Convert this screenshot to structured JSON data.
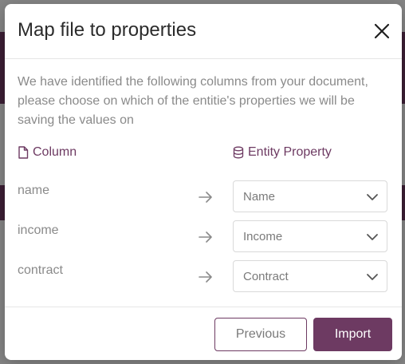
{
  "dialog": {
    "title": "Map file to properties",
    "intro": "We have identified the following columns from your document, please choose on which of the entitie's properties we will be saving the values on"
  },
  "headers": {
    "column": "Column",
    "entity_property": "Entity Property"
  },
  "mappings": [
    {
      "column": "name",
      "property": "Name"
    },
    {
      "column": "income",
      "property": "Income"
    },
    {
      "column": "contract",
      "property": "Contract"
    }
  ],
  "footer": {
    "previous_label": "Previous",
    "import_label": "Import"
  },
  "icons": {
    "close": "close-icon",
    "column": "file-icon",
    "property": "database-icon",
    "arrow": "arrow-right-icon",
    "chevron": "chevron-down-icon"
  },
  "colors": {
    "accent": "#6d3a62",
    "muted_text": "#8a8a8a",
    "title_text": "#2b2b2b"
  }
}
